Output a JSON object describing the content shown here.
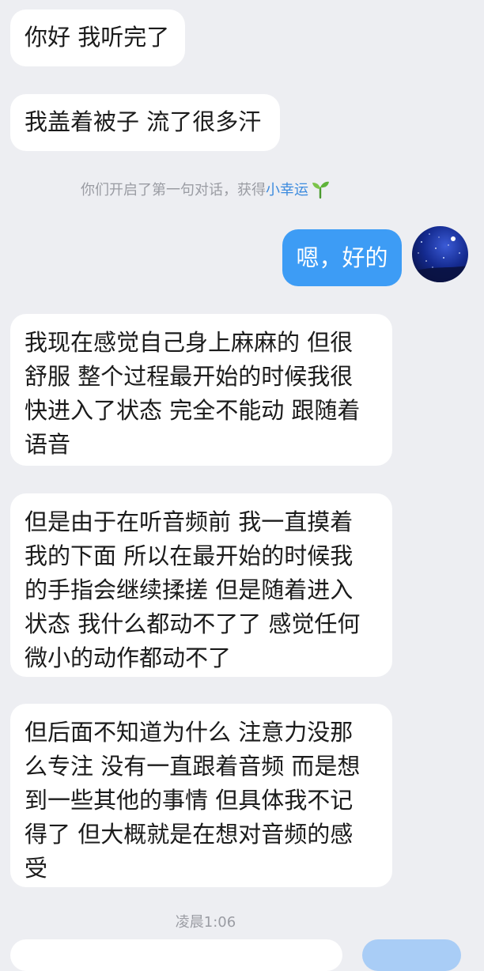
{
  "messages": {
    "m1": "你好 我听完了",
    "m2": "我盖着被子 流了很多汗",
    "m3": "我现在感觉自己身上麻麻的 但很\n舒服 整个过程最开始的时候我很\n快进入了状态 完全不能动 跟随着\n语音",
    "m4": "但是由于在听音频前 我一直摸着\n我的下面 所以在最开始的时候我\n的手指会继续揉搓 但是随着进入\n状态 我什么都动不了了 感觉任何\n微小的动作都动不了",
    "m5": "但后面不知道为什么 注意力没那\n么专注 没有一直跟着音频 而是想\n到一些其他的事情 但具体我不记\n得了 但大概就是在想对音频的感\n受"
  },
  "outgoing": {
    "m1": "嗯，好的"
  },
  "system": {
    "prefix": "你们开启了第一句对话，获得",
    "link": "小幸运"
  },
  "timestamp": "凌晨1:06",
  "colors": {
    "background": "#edeef2",
    "incoming_bubble": "#ffffff",
    "outgoing_bubble": "#3d9cf5",
    "link": "#3d8bde"
  },
  "icons": {
    "sprout": "sprout-icon",
    "avatar": "starry-night-avatar"
  }
}
